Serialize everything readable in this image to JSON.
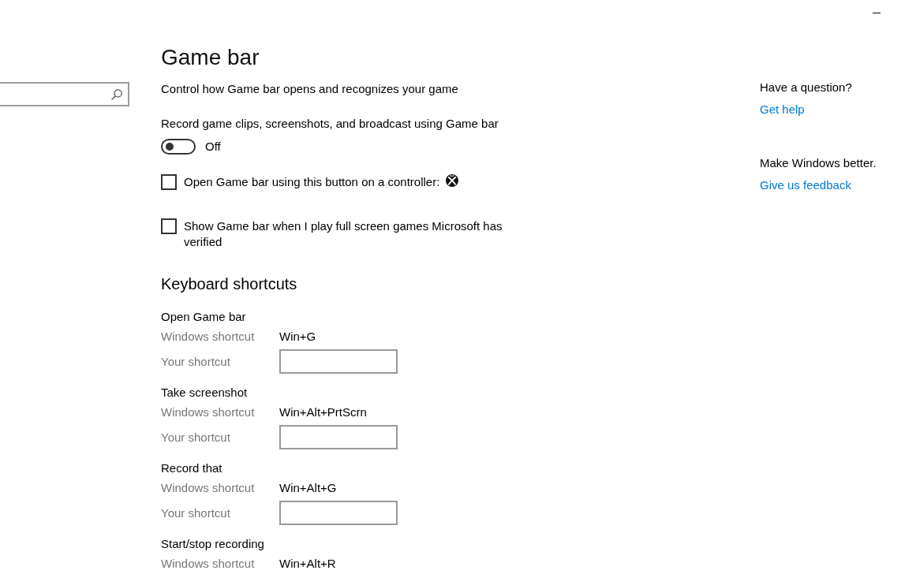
{
  "page": {
    "title": "Game bar",
    "description": "Control how Game bar opens and recognizes your game"
  },
  "toggle": {
    "label": "Record game clips, screenshots, and broadcast using Game bar",
    "on": false,
    "state_text": "Off"
  },
  "checkboxes": [
    {
      "kind": "button",
      "label": "Open Game bar using this button on a controller:",
      "checked": false
    },
    {
      "kind": "plain",
      "label": "Show Game bar when I play full screen games Microsoft has verified",
      "checked": false
    }
  ],
  "keyboard_shortcuts": {
    "title": "Keyboard shortcuts",
    "actions": [
      {
        "name": "Open Game bar",
        "rows": [
          {
            "kind": "text",
            "label": "Windows shortcut",
            "value": "Win+G"
          },
          {
            "kind": "input",
            "label": "Your shortcut"
          }
        ]
      },
      {
        "name": "Take screenshot",
        "rows": [
          {
            "kind": "text",
            "label": "Windows shortcut",
            "value": "Win+Alt+PrtScrn"
          },
          {
            "kind": "input",
            "label": "Your shortcut"
          }
        ]
      },
      {
        "name": "Record that",
        "rows": [
          {
            "kind": "text",
            "label": "Windows shortcut",
            "value": "Win+Alt+G"
          },
          {
            "kind": "input",
            "label": "Your shortcut"
          }
        ]
      },
      {
        "name": "Start/stop recording",
        "rows": [
          {
            "kind": "text",
            "label": "Windows shortcut",
            "value": "Win+Alt+R"
          }
        ]
      }
    ]
  },
  "help": [
    {
      "heading": "Have a question?",
      "link": "Get help"
    },
    {
      "heading": "Make Windows better.",
      "link": "Give us feedback"
    }
  ]
}
